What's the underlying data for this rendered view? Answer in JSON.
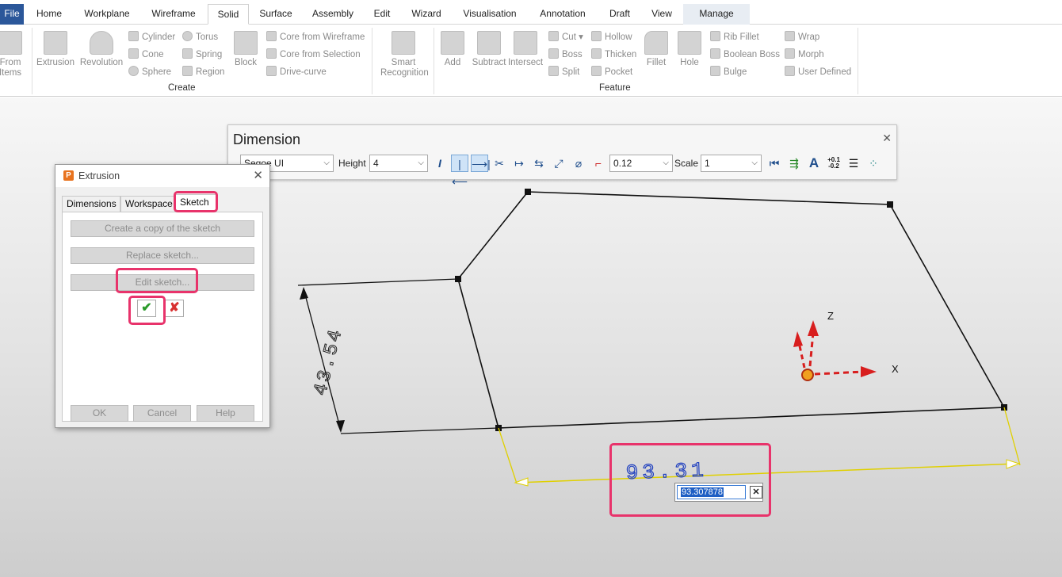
{
  "menu": {
    "tabs": [
      "File",
      "Home",
      "Workplane",
      "Wireframe",
      "Solid",
      "Surface",
      "Assembly",
      "Edit",
      "Wizard",
      "Visualisation",
      "Annotation",
      "Draft",
      "View",
      "Manage"
    ],
    "active_tab": "Solid"
  },
  "ribbon": {
    "from_items": "From\nItems",
    "create": {
      "extrusion": "Extrusion",
      "revolution": "Revolution",
      "cylinder": "Cylinder",
      "cone": "Cone",
      "sphere": "Sphere",
      "torus": "Torus",
      "spring": "Spring",
      "region": "Region",
      "block": "Block",
      "core_from_wireframe": "Core from Wireframe",
      "core_from_selection": "Core from Selection",
      "drive_curve": "Drive-curve",
      "group_label": "Create"
    },
    "feature": {
      "smart_recognition": "Smart\nRecognition",
      "add": "Add",
      "subtract": "Subtract",
      "intersect": "Intersect",
      "cut": "Cut",
      "boss": "Boss",
      "split": "Split",
      "hollow": "Hollow",
      "thicken": "Thicken",
      "pocket": "Pocket",
      "fillet": "Fillet",
      "hole": "Hole",
      "rib_fillet": "Rib Fillet",
      "boolean_boss": "Boolean Boss",
      "bulge": "Bulge",
      "wrap": "Wrap",
      "morph": "Morph",
      "user_defined": "User Defined",
      "group_label": "Feature"
    }
  },
  "dimension_toolbar": {
    "title": "Dimension",
    "font": "Segoe UI",
    "height_label": "Height",
    "height_value": "4",
    "tolerance_value": "0.12",
    "scale_label": "Scale",
    "scale_value": "1",
    "tolerance_icon_text": "+0.1\n-0.2"
  },
  "extrusion_dialog": {
    "title": "Extrusion",
    "tabs": [
      "Dimensions",
      "Workspace",
      "Sketch"
    ],
    "active_tab": "Sketch",
    "buttons": {
      "copy_sketch": "Create a copy of the sketch",
      "replace_sketch": "Replace sketch...",
      "edit_sketch": "Edit sketch...",
      "ok": "OK",
      "cancel": "Cancel",
      "help": "Help"
    }
  },
  "viewport": {
    "dim_horizontal": "93.31",
    "dim_vertical": "43.54",
    "value_entry": "93.307878",
    "axis_x": "X",
    "axis_z": "Z"
  },
  "colors": {
    "highlight": "#e8336b",
    "dimension_text": "#1f3fbf",
    "axis_red": "#d81e1e",
    "active_tab_blue": "#2b579a"
  }
}
